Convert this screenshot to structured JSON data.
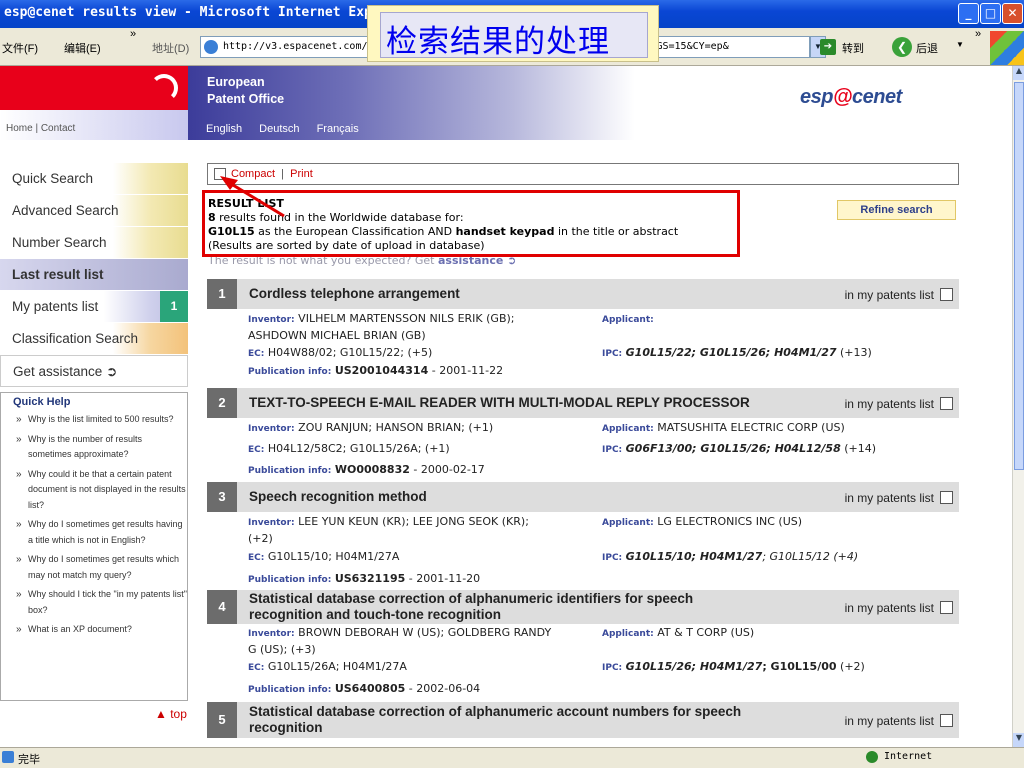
{
  "window": {
    "title": "esp@cenet results view - Microsoft Internet Explorer",
    "buttons": {
      "min": "_",
      "max": "□",
      "close": "✕"
    }
  },
  "toolbar": {
    "file_menu": "文件(F)",
    "edit_menu": "编辑(E)",
    "more": "»",
    "address_label": "地址(D)",
    "address_value": "http://v3.espacenet.com/results?sf=a&FIRST=1&F=0&CY=ep&LG=en&DB=EPODOC&PGS=15&CY=ep&",
    "go_label": "转到",
    "back_label": "后退",
    "dropdown": "▼"
  },
  "overlay_caption": "检索结果的处理",
  "header": {
    "home_contact": "Home | Contact",
    "epo_line1": "European",
    "epo_line2": "Patent Office",
    "languages": [
      "English",
      "Deutsch",
      "Français"
    ],
    "logo_pre": "esp",
    "logo_at": "@",
    "logo_post": "cenet"
  },
  "nav": {
    "items": [
      {
        "label": "Quick Search"
      },
      {
        "label": "Advanced Search"
      },
      {
        "label": "Number Search"
      },
      {
        "label": "Last result list"
      },
      {
        "label": "My patents list",
        "badge": "1"
      },
      {
        "label": "Classification Search"
      },
      {
        "label": "Get assistance ➲"
      }
    ]
  },
  "quick_help": {
    "title": "Quick Help",
    "questions": [
      "Why is the list limited to 500 results?",
      "Why is the number of results sometimes approximate?",
      "Why could it be that a certain patent document is not displayed in the results list?",
      "Why do I sometimes get results having a title which is not in English?",
      "Why do I sometimes get results which may not match my query?",
      "Why should I tick the \"in my patents list\" box?",
      "What is an XP document?"
    ]
  },
  "top_link": "▲ top",
  "options": {
    "compact": "Compact",
    "sep": "|",
    "print": "Print"
  },
  "results_header": {
    "title": "RESULT LIST",
    "count": "8",
    "found_text": " results found in the Worldwide database for:",
    "class_code": "G10L15",
    "class_text": " as the European Classification AND ",
    "keywords": "handset keypad",
    "keywords_text": " in the title or abstract",
    "sorted": "(Results are sorted by date of upload in database)",
    "notwhat": "The result is not what you expected? Get ",
    "assistance": "assistance ➲"
  },
  "refine_label": "Refine search",
  "in_my_label": "in my patents list",
  "labels": {
    "inventor": "Inventor:",
    "applicant": "Applicant:",
    "ec": "EC:",
    "ipc": "IPC:",
    "pubinfo": "Publication info:"
  },
  "results": [
    {
      "num": "1",
      "title": "Cordless telephone arrangement",
      "inventor": "VILHELM MARTENSSON NILS ERIK (GB);",
      "inventor2": "ASHDOWN MICHAEL BRIAN (GB)",
      "applicant": "",
      "ec": "H04W88/02; G10L15/22; (+5)",
      "ipc_bold": "G10L15/22; G10L15/26; H04M1/27",
      "ipc_rest": " (+13)",
      "pub": "US2001044314",
      "pub_date": " - 2001-11-22"
    },
    {
      "num": "2",
      "title": "TEXT-TO-SPEECH E-MAIL READER WITH MULTI-MODAL REPLY PROCESSOR",
      "inventor": "ZOU RANJUN; HANSON BRIAN; (+1)",
      "inventor2": "",
      "applicant": "MATSUSHITA ELECTRIC CORP (US)",
      "ec": "H04L12/58C2; G10L15/26A; (+1)",
      "ipc_bold": "G06F13/00; G10L15/26; H04L12/58",
      "ipc_rest": " (+14)",
      "pub": "WO0008832",
      "pub_date": " - 2000-02-17"
    },
    {
      "num": "3",
      "title": "Speech recognition method",
      "inventor": "LEE YUN KEUN (KR); LEE JONG SEOK (KR);",
      "inventor2": "(+2)",
      "applicant": "LG ELECTRONICS INC (US)",
      "ec": "G10L15/10; H04M1/27A",
      "ipc_bold": "G10L15/10; H04M1/27",
      "ipc_rest": "; G10L15/12 (+4)",
      "pub": "US6321195",
      "pub_date": " - 2001-11-20"
    },
    {
      "num": "4",
      "title": "Statistical database correction of alphanumeric identifiers for speech",
      "title2": "recognition and touch-tone recognition",
      "inventor": "BROWN DEBORAH W (US); GOLDBERG RANDY",
      "inventor2": "G (US); (+3)",
      "applicant": "AT & T CORP (US)",
      "ec": "G10L15/26A; H04M1/27A",
      "ipc_bold": "G10L15/26; H04M1/27",
      "ipc_rest_bold": "; G10L15/00",
      "ipc_rest": " (+2)",
      "pub": "US6400805",
      "pub_date": " - 2002-06-04"
    },
    {
      "num": "5",
      "title": "Statistical database correction of alphanumeric account numbers for speech",
      "title2": "recognition"
    }
  ],
  "status": {
    "done": "完毕",
    "zone": "Internet"
  }
}
